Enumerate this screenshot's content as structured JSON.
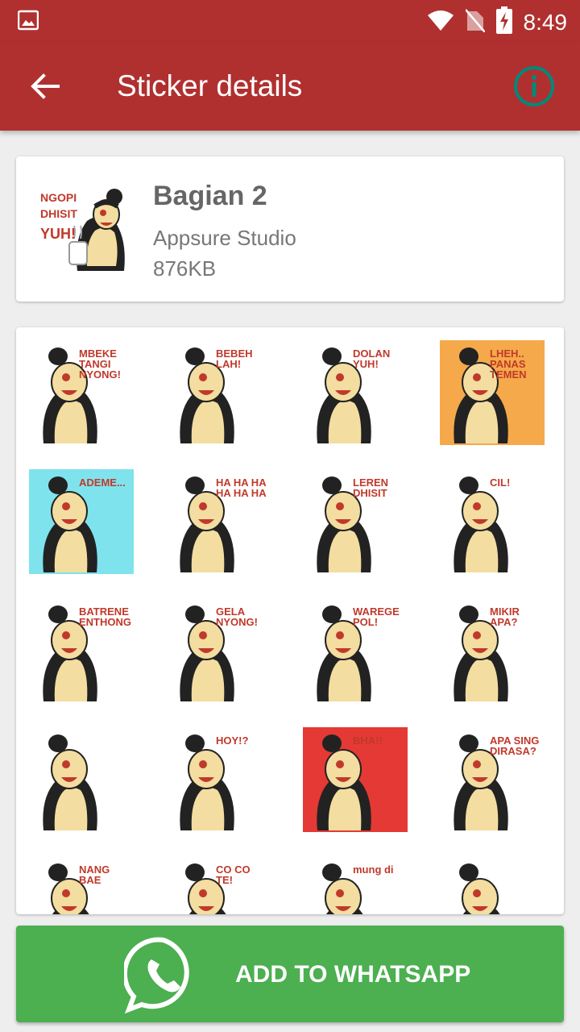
{
  "status_bar": {
    "time": "8:49"
  },
  "app_bar": {
    "title": "Sticker details"
  },
  "pack": {
    "name": "Bagian 2",
    "publisher": "Appsure Studio",
    "size": "876KB",
    "tray_caption": "NGOPI DHISIT YUH!"
  },
  "stickers": [
    {
      "caption": "MBEKE TANGI NYONG!",
      "bg": "#ffffff"
    },
    {
      "caption": "BEBEH LAH!",
      "bg": "#ffffff"
    },
    {
      "caption": "DOLAN YUH!",
      "bg": "#ffffff"
    },
    {
      "caption": "LHEH.. PANAS TEMEN",
      "bg": "#f5a94a"
    },
    {
      "caption": "ADEME...",
      "bg": "#7fe3ee"
    },
    {
      "caption": "HA HA HA HA HA HA",
      "bg": "#ffffff"
    },
    {
      "caption": "LEREN DHISIT",
      "bg": "#ffffff"
    },
    {
      "caption": "CIL!",
      "bg": "#ffffff"
    },
    {
      "caption": "BATRENE ENTHONG",
      "bg": "#ffffff"
    },
    {
      "caption": "GELA NYONG!",
      "bg": "#ffffff"
    },
    {
      "caption": "WAREGE POL!",
      "bg": "#ffffff"
    },
    {
      "caption": "MIKIR APA?",
      "bg": "#ffffff"
    },
    {
      "caption": "",
      "bg": "#ffffff"
    },
    {
      "caption": "HOY!?",
      "bg": "#ffffff"
    },
    {
      "caption": "BHA!!",
      "bg": "#e53935"
    },
    {
      "caption": "APA SING DIRASA?",
      "bg": "#ffffff"
    },
    {
      "caption": "NANG BAE",
      "bg": "#ffffff"
    },
    {
      "caption": "CO CO TE!",
      "bg": "#ffffff"
    },
    {
      "caption": "mung di",
      "bg": "#ffffff"
    },
    {
      "caption": "",
      "bg": "#ffffff"
    }
  ],
  "action": {
    "label": "ADD TO WHATSAPP"
  },
  "colors": {
    "primary": "#b03030",
    "accent": "#00897b",
    "whatsapp": "#4caf50"
  },
  "icons": {
    "back": "arrow-left-icon",
    "info": "info-icon",
    "whatsapp": "whatsapp-icon",
    "wifi": "wifi-icon",
    "no_sim": "no-sim-icon",
    "battery": "battery-charging-icon",
    "gallery": "image-icon"
  }
}
